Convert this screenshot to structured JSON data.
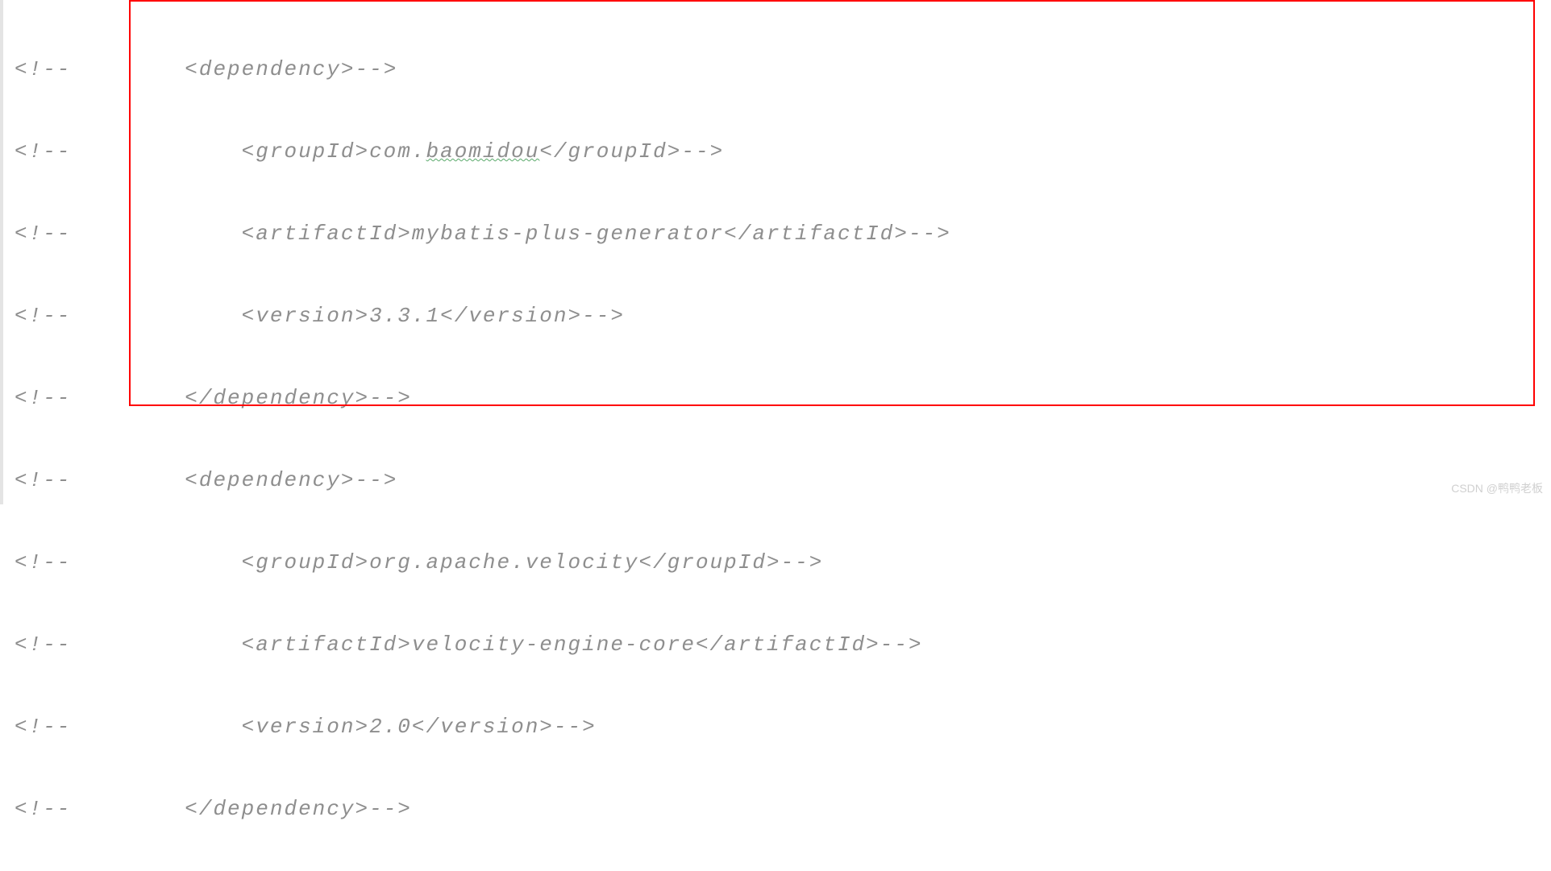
{
  "lines": [
    {
      "prefix": "<!--",
      "indent": "        ",
      "content_before": "<dependency>",
      "squiggle": "",
      "content_after": "",
      "trail": "-->"
    },
    {
      "prefix": "<!--",
      "indent": "            ",
      "content_before": "<groupId>com.",
      "squiggle": "baomidou",
      "content_after": "</groupId>",
      "trail": "-->"
    },
    {
      "prefix": "<!--",
      "indent": "            ",
      "content_before": "<artifactId>mybatis-plus-generator</artifactId>",
      "squiggle": "",
      "content_after": "",
      "trail": "-->"
    },
    {
      "prefix": "<!--",
      "indent": "            ",
      "content_before": "<version>3.3.1</version>",
      "squiggle": "",
      "content_after": "",
      "trail": "-->"
    },
    {
      "prefix": "<!--",
      "indent": "        ",
      "content_before": "</dependency>",
      "squiggle": "",
      "content_after": "",
      "trail": "-->"
    },
    {
      "prefix": "<!--",
      "indent": "        ",
      "content_before": "<dependency>",
      "squiggle": "",
      "content_after": "",
      "trail": "-->"
    },
    {
      "prefix": "<!--",
      "indent": "            ",
      "content_before": "<groupId>org.apache.velocity</groupId>",
      "squiggle": "",
      "content_after": "",
      "trail": "-->"
    },
    {
      "prefix": "<!--",
      "indent": "            ",
      "content_before": "<artifactId>velocity-engine-core</artifactId>",
      "squiggle": "",
      "content_after": "",
      "trail": "-->"
    },
    {
      "prefix": "<!--",
      "indent": "            ",
      "content_before": "<version>2.0</version>",
      "squiggle": "",
      "content_after": "",
      "trail": "-->"
    },
    {
      "prefix": "<!--",
      "indent": "        ",
      "content_before": "</dependency>",
      "squiggle": "",
      "content_after": "",
      "trail": "-->"
    }
  ],
  "watermark": "CSDN @鸭鸭老板"
}
